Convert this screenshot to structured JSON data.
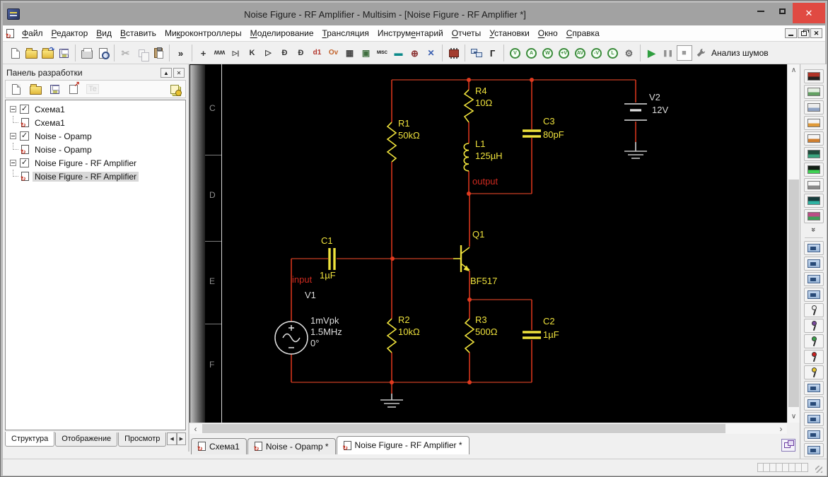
{
  "window": {
    "title": "Noise Figure - RF Amplifier - Multisim - [Noise Figure - RF Amplifier *]"
  },
  "menubar": {
    "items": [
      {
        "label": "Файл",
        "accel": 0
      },
      {
        "label": "Редактор",
        "accel": 0
      },
      {
        "label": "Вид",
        "accel": 0
      },
      {
        "label": "Вставить",
        "accel": 0
      },
      {
        "label": "Микроконтроллеры",
        "accel": 2
      },
      {
        "label": "Моделирование",
        "accel": 0
      },
      {
        "label": "Трансляция",
        "accel": 0
      },
      {
        "label": "Инструментарий",
        "accel": 7
      },
      {
        "label": "Отчеты",
        "accel": 0
      },
      {
        "label": "Установки",
        "accel": 0
      },
      {
        "label": "Окно",
        "accel": 0
      },
      {
        "label": "Справка",
        "accel": 0
      }
    ]
  },
  "main_toolbar": {
    "analysis_label": "Анализ шумов",
    "groups": [
      {
        "items": [
          {
            "name": "new-file-icon",
            "kind": "page"
          },
          {
            "name": "open-file-icon",
            "kind": "folder"
          },
          {
            "name": "open-sample-icon",
            "kind": "folder2"
          },
          {
            "name": "save-icon",
            "kind": "floppy"
          }
        ]
      },
      {
        "items": [
          {
            "name": "print-icon",
            "kind": "printer"
          },
          {
            "name": "print-preview-icon",
            "kind": "preview"
          }
        ]
      },
      {
        "items": [
          {
            "name": "cut-icon",
            "glyph": "✂",
            "color": "#555",
            "size": "14px",
            "disabled": true
          },
          {
            "name": "copy-icon",
            "kind": "copy",
            "disabled": true
          },
          {
            "name": "paste-icon",
            "kind": "paste"
          }
        ]
      },
      {
        "items": [
          {
            "name": "more-toolbar-chevron",
            "glyph": "»",
            "color": "#222",
            "size": "13px"
          }
        ]
      },
      {
        "items": [
          {
            "name": "place-source-icon",
            "glyph": "+",
            "color": "#333",
            "size": "13px"
          },
          {
            "name": "place-basic-icon",
            "glyph": "ʍʍ",
            "color": "#333",
            "size": "10px"
          },
          {
            "name": "place-diode-icon",
            "glyph": "▷|",
            "color": "#333",
            "size": "9px"
          },
          {
            "name": "place-transistor-icon",
            "glyph": "K",
            "color": "#333",
            "size": "11px"
          },
          {
            "name": "place-analog-icon",
            "glyph": "▷",
            "color": "#333",
            "size": "11px"
          },
          {
            "name": "place-ttl-icon",
            "glyph": "Ð",
            "color": "#333",
            "size": "11px"
          },
          {
            "name": "place-cmos-icon",
            "glyph": "Đ",
            "color": "#333",
            "size": "11px"
          },
          {
            "name": "place-misc-digital-icon",
            "glyph": "d1",
            "color": "#b3342a",
            "size": "10px"
          },
          {
            "name": "place-mixed-icon",
            "glyph": "Ov",
            "color": "#c2622a",
            "size": "10px"
          },
          {
            "name": "place-indicator-icon",
            "glyph": "▦",
            "color": "#444",
            "size": "12px"
          },
          {
            "name": "place-power-icon",
            "glyph": "▣",
            "color": "#3e6e3e",
            "size": "12px"
          },
          {
            "name": "place-misc-icon",
            "glyph": "MISC",
            "color": "#111",
            "size": "6px"
          },
          {
            "name": "place-peripherals-icon",
            "glyph": "▬",
            "color": "#0b8a8a",
            "size": "12px"
          },
          {
            "name": "place-rf-icon",
            "glyph": "⊕",
            "color": "#8a3030",
            "size": "13px"
          },
          {
            "name": "place-electromech-icon",
            "glyph": "✕",
            "color": "#3a5fb0",
            "size": "12px"
          }
        ]
      },
      {
        "items": [
          {
            "name": "place-component-icon",
            "kind": "chip"
          }
        ]
      },
      {
        "items": [
          {
            "name": "hierarchy-icon",
            "kind": "hier"
          },
          {
            "name": "place-bus-icon",
            "glyph": "Г",
            "color": "#222",
            "size": "13px"
          }
        ]
      },
      {
        "items": [
          {
            "name": "voltage-probe-icon",
            "circle": "V"
          },
          {
            "name": "current-probe-icon",
            "circle": "A"
          },
          {
            "name": "power-probe-icon",
            "circle": "W"
          },
          {
            "name": "diff-voltage-probe-icon",
            "circle": "+V"
          },
          {
            "name": "gain-probe-icon",
            "circle": "AV"
          },
          {
            "name": "ref-voltage-probe-icon",
            "circle": "-V"
          },
          {
            "name": "digital-probe-icon",
            "circle": "L"
          },
          {
            "name": "probe-settings-gear-icon",
            "glyph": "⚙",
            "color": "#666",
            "size": "13px"
          }
        ]
      },
      {
        "items": [
          {
            "name": "run-button",
            "glyph": "▶",
            "color": "#2f9e3f",
            "size": "14px"
          },
          {
            "name": "pause-button",
            "glyph": "❚❚",
            "color": "#909090",
            "size": "9px"
          },
          {
            "name": "stop-button",
            "glyph": "■",
            "color": "#9a9a9a",
            "size": "11px",
            "boxed": true
          },
          {
            "name": "wrench-icon",
            "kind": "wrench"
          }
        ]
      }
    ]
  },
  "design_toolbox": {
    "title": "Панель разработки",
    "toolbar": [
      {
        "name": "new-schematic-icon",
        "kind": "page"
      },
      {
        "name": "open-design-icon",
        "kind": "folder"
      },
      {
        "name": "save-design-icon",
        "kind": "floppy"
      },
      {
        "name": "new-sheet-icon",
        "kind": "pagearrow"
      },
      {
        "name": "text-te-icon",
        "glyph": "Te",
        "disabled": true
      },
      {
        "name": "history-pages-icon",
        "kind": "stack",
        "right": true
      }
    ],
    "tree": [
      {
        "label": "Схема1",
        "child": "Схема1",
        "selected": false
      },
      {
        "label": "Noise - Opamp",
        "child": "Noise - Opamp",
        "selected": false
      },
      {
        "label": "Noise Figure - RF Amplifier",
        "child": "Noise Figure - RF Amplifier",
        "selected": true
      }
    ],
    "tabs": [
      {
        "label": "Структура",
        "active": true
      },
      {
        "label": "Отображение",
        "active": false
      },
      {
        "label": "Просмотр",
        "active": false
      }
    ]
  },
  "canvas": {
    "row_letters": [
      "C",
      "D",
      "E",
      "F"
    ]
  },
  "circuit": {
    "components": {
      "R1": {
        "ref": "R1",
        "value": "50kΩ"
      },
      "R2": {
        "ref": "R2",
        "value": "10kΩ"
      },
      "R3": {
        "ref": "R3",
        "value": "500Ω"
      },
      "R4": {
        "ref": "R4",
        "value": "10Ω"
      },
      "L1": {
        "ref": "L1",
        "value": "125µH"
      },
      "C1": {
        "ref": "C1",
        "value": "1µF"
      },
      "C2": {
        "ref": "C2",
        "value": "1µF"
      },
      "C3": {
        "ref": "C3",
        "value": "80pF"
      },
      "Q1": {
        "ref": "Q1",
        "value": "BF517"
      },
      "V1": {
        "ref": "V1",
        "value_lines": [
          "1mVpk",
          "1.5MHz",
          "0°"
        ]
      },
      "V2": {
        "ref": "V2",
        "value": "12V"
      }
    },
    "net_labels": {
      "input": "input",
      "output": "output"
    }
  },
  "document_tabs": [
    {
      "label": "Схема1",
      "active": false
    },
    {
      "label": "Noise - Opamp *",
      "active": false
    },
    {
      "label": "Noise Figure - RF Amplifier *",
      "active": true
    }
  ],
  "instruments": {
    "top": [
      {
        "name": "multimeter-icon",
        "c1": "#b03326",
        "c2": "#26211e"
      },
      {
        "name": "function-generator-icon",
        "c1": "#e4efe2",
        "c2": "#63a063"
      },
      {
        "name": "wattmeter-icon",
        "c1": "#ececec",
        "c2": "#8fa3c4"
      },
      {
        "name": "oscilloscope-icon",
        "c1": "#f4f4f4",
        "c2": "#e09a38"
      },
      {
        "name": "four-channel-oscilloscope-icon",
        "c1": "#f4f4f4",
        "c2": "#cf7e2e"
      },
      {
        "name": "bode-plotter-icon",
        "c1": "#1f4a3b",
        "c2": "#39a47e"
      },
      {
        "name": "frequency-counter-icon",
        "c1": "#131f16",
        "c2": "#3fd254"
      },
      {
        "name": "word-generator-icon",
        "c1": "#f6f6f6",
        "c2": "#8a8a8a"
      },
      {
        "name": "logic-analyzer-icon",
        "c1": "#173c3c",
        "c2": "#2fb3a3"
      },
      {
        "name": "logic-converter-icon",
        "c1": "#bb4e86",
        "c2": "#3f9e58"
      }
    ],
    "more_chevron": "»",
    "bottom": [
      {
        "name": "probe-instrument-icon-1",
        "kind": "meter"
      },
      {
        "name": "probe-instrument-icon-2",
        "kind": "meter"
      },
      {
        "name": "probe-instrument-icon-3",
        "kind": "meter"
      },
      {
        "name": "probe-instrument-icon-4",
        "kind": "meter"
      },
      {
        "name": "measurement-probe-white-icon",
        "kind": "probe",
        "color": "#f2f2f2"
      },
      {
        "name": "measurement-probe-purple-icon",
        "kind": "probe",
        "color": "#7a4a9e"
      },
      {
        "name": "measurement-probe-green-icon",
        "kind": "probe",
        "color": "#3aa04a"
      },
      {
        "name": "measurement-probe-red-icon",
        "kind": "probe",
        "color": "#cc2222"
      },
      {
        "name": "measurement-probe-yellow-icon",
        "kind": "probe",
        "color": "#e8c830"
      },
      {
        "name": "probe-instrument-icon-5",
        "kind": "meter"
      },
      {
        "name": "probe-instrument-icon-6",
        "kind": "meter"
      },
      {
        "name": "probe-instrument-icon-7",
        "kind": "meter"
      },
      {
        "name": "probe-instrument-icon-8",
        "kind": "meter"
      },
      {
        "name": "probe-instrument-icon-9",
        "kind": "meter"
      }
    ]
  },
  "colors": {
    "wire": "#d6341c",
    "rail": "#a8341e",
    "component": "#eee13c",
    "net_label": "#cc2a1f",
    "junction": "#e03a1f",
    "canvas_bg": "#000000",
    "close_button": "#e04a42",
    "run_button": "#2f9e3f"
  }
}
